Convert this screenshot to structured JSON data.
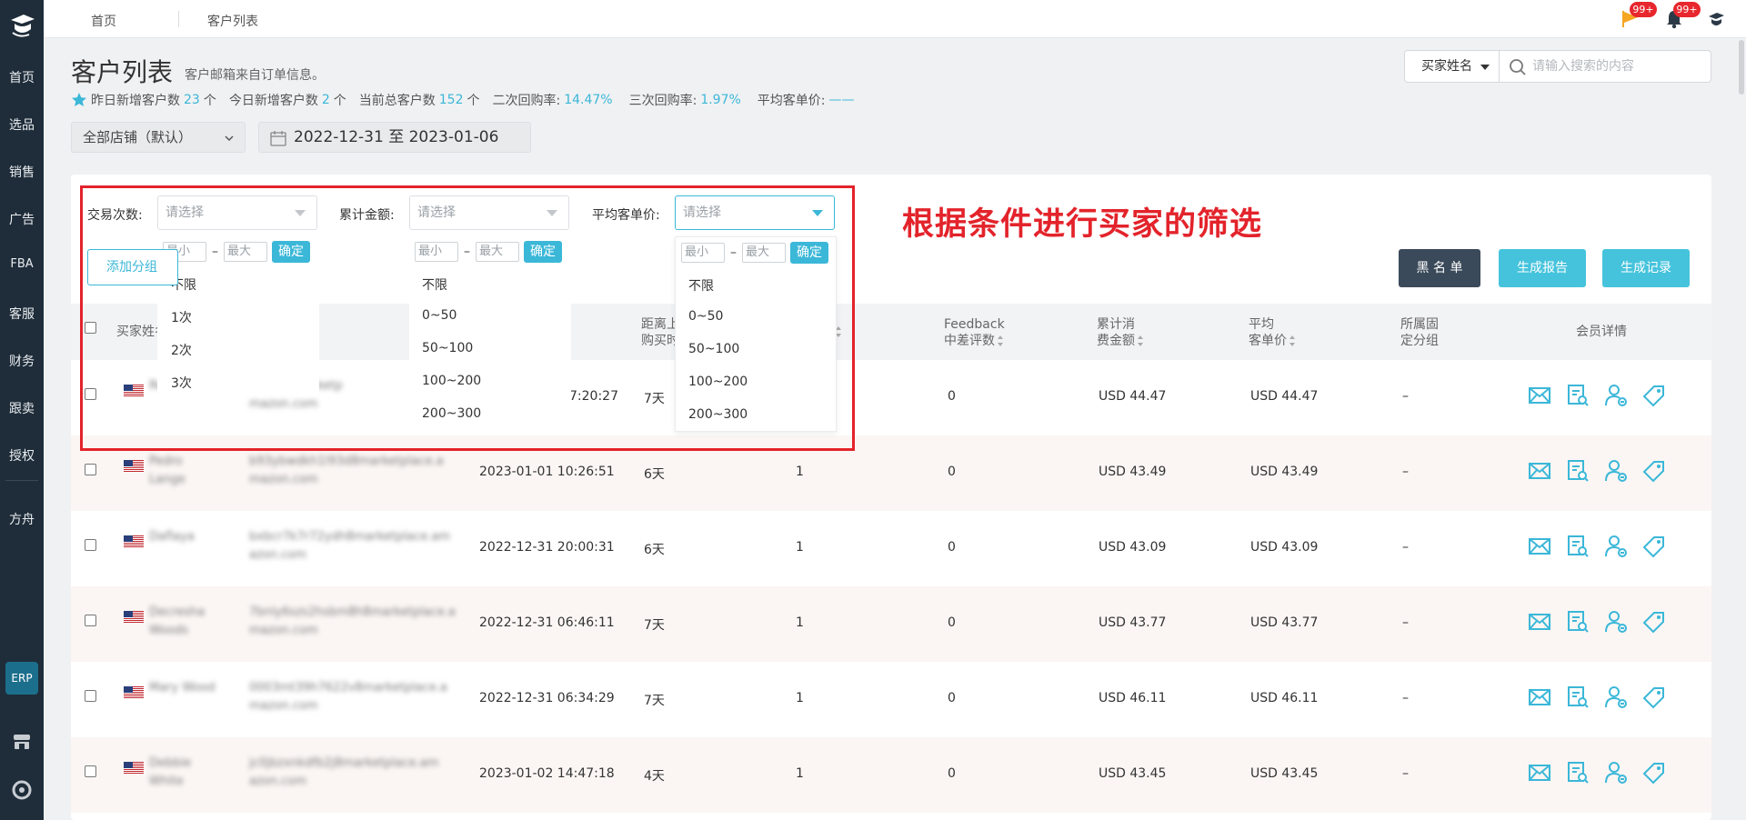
{
  "sidebar": {
    "items": [
      "首页",
      "选品",
      "销售",
      "广告",
      "FBA",
      "客服",
      "财务",
      "跟卖",
      "授权"
    ],
    "extra": "方舟",
    "erp": "ERP"
  },
  "breadcrumb": {
    "home": "首页",
    "current": "客户列表"
  },
  "notifications": {
    "flag_badge": "99+",
    "bell_badge": "99+"
  },
  "page": {
    "title": "客户列表",
    "subtitle": "客户邮箱来自订单信息。"
  },
  "stats": {
    "yesterday_new_label": "昨日新增客户数",
    "yesterday_new": "23",
    "unit1": "个",
    "today_new_label": "今日新增客户数",
    "today_new": "2",
    "unit2": "个",
    "total_label": "当前总客户数",
    "total": "152",
    "unit3": "个",
    "repurchase2_label": "二次回购率:",
    "repurchase2": "14.47%",
    "repurchase3_label": "三次回购率:",
    "repurchase3": "1.97%",
    "avg_price_label": "平均客单价:",
    "avg_price": "——"
  },
  "store_select": "全部店铺（默认）",
  "date_range": "2022-12-31 至 2023-01-06",
  "search": {
    "field": "买家姓名",
    "placeholder": "请输入搜索的内容"
  },
  "filters": {
    "trade_count": {
      "label": "交易次数:",
      "placeholder": "请选择",
      "min": "最小",
      "max": "最大",
      "ok": "确定",
      "dash": "–",
      "options": [
        "不限",
        "1次",
        "2次",
        "3次"
      ]
    },
    "total_amount": {
      "label": "累计金额:",
      "placeholder": "请选择",
      "min": "最小",
      "max": "最大",
      "ok": "确定",
      "dash": "–",
      "options": [
        "不限",
        "0~50",
        "50~100",
        "100~200",
        "200~300"
      ]
    },
    "avg_price": {
      "label": "平均客单价:",
      "placeholder": "请选择",
      "min": "最小",
      "max": "最大",
      "ok": "确定",
      "dash": "–",
      "options": [
        "不限",
        "0~50",
        "50~100",
        "100~200",
        "200~300"
      ]
    }
  },
  "annotation": "根据条件进行买家的筛选",
  "add_group": "添加分组",
  "buttons": {
    "blacklist": "黑 名 单",
    "report": "生成报告",
    "records": "生成记录"
  },
  "table": {
    "headers": {
      "buyer_name": "买家姓名",
      "days_since_1": "距离上",
      "days_since_2": "购买时",
      "feedback_1": "Feedback",
      "feedback_2": "中差评数",
      "total_spend_1": "累计消",
      "total_spend_2": "费金额",
      "avg_price_1": "平均",
      "avg_price_2": "客单价",
      "group_1": "所属固",
      "group_2": "定分组",
      "member": "会员详情"
    },
    "rows": [
      {
        "name_l1": "Re…",
        "name_l2": "",
        "email_l1": "d3mcj8marketp",
        "email_l2": "mazon.com",
        "time": "7:20:27",
        "days": "7天",
        "count": "",
        "feedback": "0",
        "total": "USD 44.47",
        "avg": "USD 44.47",
        "group": "–"
      },
      {
        "name_l1": "Pedro",
        "name_l2": "Lange",
        "email_l1": "b93ybwdkh1l93d8marketplace.a",
        "email_l2": "mazon.com",
        "time": "2023-01-01 10:26:51",
        "days": "6天",
        "count": "1",
        "feedback": "0",
        "total": "USD 43.49",
        "avg": "USD 43.49",
        "group": "–"
      },
      {
        "name_l1": "Daflaya",
        "name_l2": "",
        "email_l1": "bxbcr7k7r72ydh8marketplace.am",
        "email_l2": "azon.com",
        "time": "2022-12-31 20:00:31",
        "days": "6天",
        "count": "1",
        "feedback": "0",
        "total": "USD 43.09",
        "avg": "USD 43.09",
        "group": "–"
      },
      {
        "name_l1": "Decresha",
        "name_l2": "Woods",
        "email_l1": "7bnly6szs2hsbm8h8marketplace.a",
        "email_l2": "mazon.com",
        "time": "2022-12-31 06:46:11",
        "days": "7天",
        "count": "1",
        "feedback": "0",
        "total": "USD 43.77",
        "avg": "USD 43.77",
        "group": "–"
      },
      {
        "name_l1": "Mary Wood",
        "name_l2": "",
        "email_l1": "0003mt39h7622v8marketplace.a",
        "email_l2": "mazon.com",
        "time": "2022-12-31 06:34:29",
        "days": "7天",
        "count": "1",
        "feedback": "0",
        "total": "USD 46.11",
        "avg": "USD 46.11",
        "group": "–"
      },
      {
        "name_l1": "Debbie",
        "name_l2": "White",
        "email_l1": "jc0jbzxnkdfb2j8marketplace.am",
        "email_l2": "azon.com",
        "time": "2023-01-02 14:47:18",
        "days": "4天",
        "count": "1",
        "feedback": "0",
        "total": "USD 43.45",
        "avg": "USD 43.45",
        "group": "–"
      }
    ]
  },
  "colors": {
    "accent": "#3bb7d8",
    "annotation": "#e3232b",
    "sidebar": "#1f2d3a",
    "dark_button": "#3b4a5a"
  }
}
